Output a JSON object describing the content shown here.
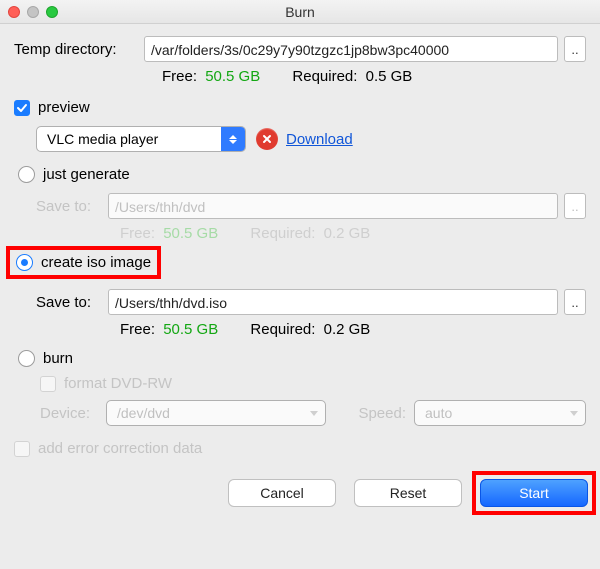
{
  "window": {
    "title": "Burn"
  },
  "temp": {
    "label": "Temp directory:",
    "path": "/var/folders/3s/0c29y7y90tzgzc1jp8bw3pc40000",
    "browse": "..",
    "free_label": "Free:",
    "free_value": "50.5 GB",
    "required_label": "Required:",
    "required_value": "0.5 GB"
  },
  "preview": {
    "checked": true,
    "label": "preview",
    "player": "VLC media player",
    "download": "Download"
  },
  "just_generate": {
    "selected": false,
    "label": "just generate",
    "save_label": "Save to:",
    "save_path": "/Users/thh/dvd",
    "browse": "..",
    "free_label": "Free:",
    "free_value": "50.5 GB",
    "required_label": "Required:",
    "required_value": "0.2 GB"
  },
  "create_iso": {
    "selected": true,
    "label": "create iso image",
    "save_label": "Save to:",
    "save_path": "/Users/thh/dvd.iso",
    "browse": "..",
    "free_label": "Free:",
    "free_value": "50.5 GB",
    "required_label": "Required:",
    "required_value": "0.2 GB"
  },
  "burn": {
    "selected": false,
    "label": "burn",
    "format_label": "format DVD-RW",
    "device_label": "Device:",
    "device_value": "/dev/dvd",
    "speed_label": "Speed:",
    "speed_value": "auto"
  },
  "error_correction": {
    "label": "add error correction data"
  },
  "buttons": {
    "cancel": "Cancel",
    "reset": "Reset",
    "start": "Start"
  }
}
